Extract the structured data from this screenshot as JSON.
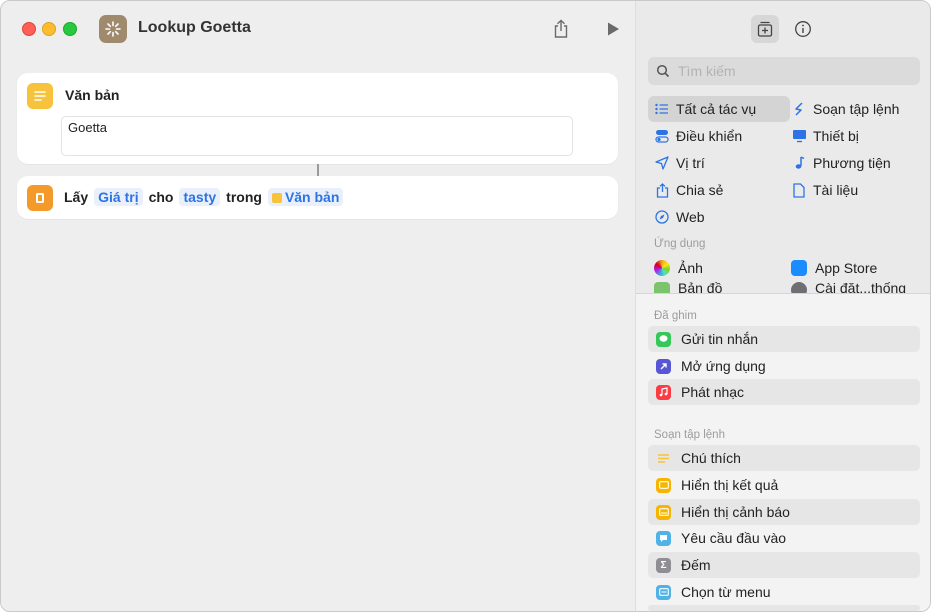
{
  "window": {
    "title": "Lookup Goetta"
  },
  "editor": {
    "text_action": {
      "title": "Văn bản",
      "content": "Goetta"
    },
    "get_action": {
      "verb": "Lấy",
      "value_token": "Giá trị",
      "for_word": "cho",
      "key_token": "tasty",
      "in_word": "trong",
      "source_token": "Văn bản"
    }
  },
  "sidebar": {
    "search_placeholder": "Tìm kiếm",
    "categories": [
      {
        "label": "Tất cả tác vụ",
        "icon": "list-icon",
        "selected": true
      },
      {
        "label": "Soạn tập lệnh",
        "icon": "scripting-icon"
      },
      {
        "label": "Điều khiển",
        "icon": "toggle-icon"
      },
      {
        "label": "Thiết bị",
        "icon": "display-icon"
      },
      {
        "label": "Vị trí",
        "icon": "location-arrow-icon"
      },
      {
        "label": "Phương tiện",
        "icon": "music-note-icon"
      },
      {
        "label": "Chia sẻ",
        "icon": "share-icon"
      },
      {
        "label": "Tài liệu",
        "icon": "document-icon"
      },
      {
        "label": "Web",
        "icon": "compass-icon"
      }
    ],
    "apps_label": "Ứng dụng",
    "apps": [
      {
        "label": "Ảnh",
        "icon": "photos-icon"
      },
      {
        "label": "App Store",
        "icon": "app-store-icon"
      },
      {
        "label": "Bản đồ",
        "icon": "maps-icon"
      },
      {
        "label": "Cài đặt...thống",
        "icon": "settings-icon"
      }
    ],
    "pinned_label": "Đã ghim",
    "pinned": [
      {
        "label": "Gửi tin nhắn",
        "icon": "messages-icon",
        "color": "#34c759"
      },
      {
        "label": "Mở ứng dụng",
        "icon": "open-app-icon",
        "color": "#5856d6"
      },
      {
        "label": "Phát nhạc",
        "icon": "music-icon",
        "color": "#fc3c44"
      }
    ],
    "scripting_label": "Soạn tập lệnh",
    "scripting": [
      {
        "label": "Chú thích",
        "icon": "comment-icon",
        "color": "#f7c23c"
      },
      {
        "label": "Hiển thị kết quả",
        "icon": "show-result-icon",
        "color": "#f7b500"
      },
      {
        "label": "Hiển thị cảnh báo",
        "icon": "alert-icon",
        "color": "#f7b500"
      },
      {
        "label": "Yêu cầu đầu vào",
        "icon": "ask-input-icon",
        "color": "#4fb3e8"
      },
      {
        "label": "Đếm",
        "icon": "sigma-icon",
        "color": "#8e8e93"
      },
      {
        "label": "Chọn từ menu",
        "icon": "menu-icon",
        "color": "#4fb3e8"
      }
    ]
  }
}
